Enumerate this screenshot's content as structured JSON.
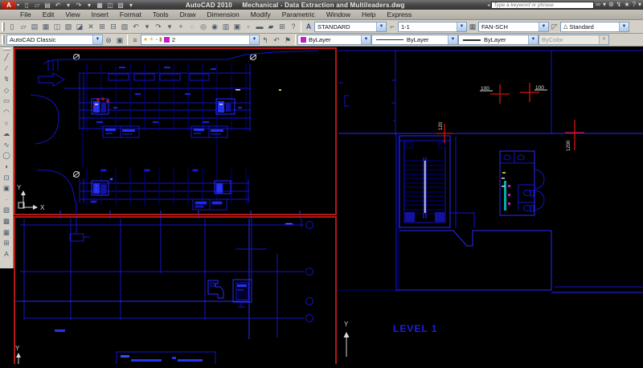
{
  "window": {
    "logo_letter": "A",
    "app_name": "AutoCAD 2010",
    "doc_name": "Mechanical - Data Extraction and Multileaders.dwg",
    "search_placeholder": "Type a keyword or phrase",
    "quick_icons": [
      {
        "n": "new-icon",
        "g": "▯"
      },
      {
        "n": "open-icon",
        "g": "▱"
      },
      {
        "n": "save-icon",
        "g": "▤"
      },
      {
        "n": "undo-icon",
        "g": "↶"
      },
      {
        "n": "undo-dropdown-icon",
        "g": "▾"
      },
      {
        "n": "redo-icon",
        "g": "↷"
      },
      {
        "n": "redo-dropdown-icon",
        "g": "▾"
      },
      {
        "n": "plot-icon",
        "g": "▦"
      },
      {
        "n": "plot-preview-icon",
        "g": "◫"
      },
      {
        "n": "publish-icon",
        "g": "▧"
      },
      {
        "n": "customize-dropdown-icon",
        "g": "▾"
      }
    ],
    "infocenter_icons": [
      {
        "n": "search-icon",
        "g": "∞"
      },
      {
        "n": "search-dropdown-icon",
        "g": "▾"
      },
      {
        "n": "comm-center-icon",
        "g": "⊛"
      },
      {
        "n": "subscription-icon",
        "g": "↯"
      },
      {
        "n": "favorites-icon",
        "g": "★"
      },
      {
        "n": "help-icon",
        "g": "?"
      },
      {
        "n": "help-dropdown-icon",
        "g": "▾"
      }
    ]
  },
  "menus": [
    {
      "n": "menu-file",
      "label": "File"
    },
    {
      "n": "menu-edit",
      "label": "Edit"
    },
    {
      "n": "menu-view",
      "label": "View"
    },
    {
      "n": "menu-insert",
      "label": "Insert"
    },
    {
      "n": "menu-format",
      "label": "Format"
    },
    {
      "n": "menu-tools",
      "label": "Tools"
    },
    {
      "n": "menu-draw",
      "label": "Draw"
    },
    {
      "n": "menu-dimension",
      "label": "Dimension"
    },
    {
      "n": "menu-modify",
      "label": "Modify"
    },
    {
      "n": "menu-parametric",
      "label": "Parametric"
    },
    {
      "n": "menu-window",
      "label": "Window"
    },
    {
      "n": "menu-help",
      "label": "Help"
    },
    {
      "n": "menu-express",
      "label": "Express"
    }
  ],
  "toolbar1": {
    "icons": [
      {
        "n": "qnew-icon",
        "g": "▯"
      },
      {
        "n": "open-icon",
        "g": "▱"
      },
      {
        "n": "qsave-icon",
        "g": "▤"
      },
      {
        "n": "plot-icon",
        "g": "▦"
      },
      {
        "n": "plot-preview-icon",
        "g": "◫"
      },
      {
        "n": "publish-icon",
        "g": "▧"
      },
      {
        "n": "3ddwf-icon",
        "g": "◪"
      },
      {
        "n": "cut-icon",
        "g": "✕"
      },
      {
        "n": "copy-icon",
        "g": "⊞"
      },
      {
        "n": "paste-icon",
        "g": "⊟"
      },
      {
        "n": "match-properties-icon",
        "g": "▨"
      },
      {
        "n": "undo-icon",
        "g": "↶"
      },
      {
        "n": "undo-dropdown-icon",
        "g": "▾"
      },
      {
        "n": "redo-icon",
        "g": "↷"
      },
      {
        "n": "redo-dropdown-icon",
        "g": "▾"
      },
      {
        "n": "pan-icon",
        "g": "+"
      },
      {
        "n": "zoom-realtime-icon",
        "g": "◌"
      },
      {
        "n": "zoom-window-icon",
        "g": "◎"
      },
      {
        "n": "zoom-previous-icon",
        "g": "◉"
      },
      {
        "n": "properties-icon",
        "g": "▥"
      },
      {
        "n": "designcenter-icon",
        "g": "▣"
      },
      {
        "n": "tool-palettes-icon",
        "g": "▫"
      },
      {
        "n": "sheet-set-manager-icon",
        "g": "▬"
      },
      {
        "n": "markup-icon",
        "g": "▰"
      },
      {
        "n": "quickcalc-icon",
        "g": "⊞"
      },
      {
        "n": "help-icon",
        "g": "?"
      }
    ],
    "text_style_icon": "A",
    "text_style": "STANDARD",
    "dim_style": "1-1",
    "table_style": "FAN-SCH",
    "mleader_glyph": "△",
    "mleader_style": "Standard"
  },
  "toolbar2": {
    "workspace": "AutoCAD Classic",
    "workspace_icons": [
      {
        "n": "workspace-settings-icon",
        "g": "⊛"
      },
      {
        "n": "my-workspace-icon",
        "g": "▣"
      }
    ],
    "layer_properties_icon": "≡",
    "layer": {
      "bulb_icon": "●",
      "sun_icon": "☀",
      "plot_icon": "▫",
      "lock_icon": "▮",
      "color_hex": "#c320c3",
      "name": "2"
    },
    "layer_buttons": [
      {
        "n": "make-object-layer-current-icon",
        "g": "↰"
      },
      {
        "n": "layer-previous-icon",
        "g": "↶"
      },
      {
        "n": "layer-states-icon",
        "g": "⚑"
      }
    ],
    "color_value": "ByLayer",
    "color_hex": "#c320c3",
    "linetype_value": "ByLayer",
    "lineweight_value": "ByLayer",
    "plot_style_value": "ByColor"
  },
  "draw_toolbar": {
    "icons": [
      {
        "n": "line-icon",
        "g": "╱"
      },
      {
        "n": "construction-line-icon",
        "g": "∕"
      },
      {
        "n": "polyline-icon",
        "g": "↯"
      },
      {
        "n": "polygon-icon",
        "g": "◇"
      },
      {
        "n": "rectangle-icon",
        "g": "▭"
      },
      {
        "n": "arc-icon",
        "g": "◠"
      },
      {
        "n": "circle-icon",
        "g": "○"
      },
      {
        "n": "revision-cloud-icon",
        "g": "☁"
      },
      {
        "n": "spline-icon",
        "g": "∿"
      },
      {
        "n": "ellipse-icon",
        "g": "◯"
      },
      {
        "n": "ellipse-arc-icon",
        "g": "◖"
      },
      {
        "n": "insert-block-icon",
        "g": "⊡"
      },
      {
        "n": "make-block-icon",
        "g": "▣"
      },
      {
        "n": "point-icon",
        "g": "∙"
      },
      {
        "n": "hatch-icon",
        "g": "▨"
      },
      {
        "n": "gradient-icon",
        "g": "▩"
      },
      {
        "n": "region-icon",
        "g": "▦"
      },
      {
        "n": "table-icon",
        "g": "⊞"
      },
      {
        "n": "multiline-text-icon",
        "g": "A"
      }
    ]
  },
  "canvas": {
    "level_label": "LEVEL 1",
    "dims": {
      "d1": "100",
      "d2": "100",
      "d3": "120",
      "d4": "1200"
    },
    "ucs": {
      "x": "X",
      "y": "Y"
    },
    "colors": {
      "line_blue": "#1414cc",
      "bright_blue": "#2a2aff",
      "viewport_red": "#b41812"
    }
  }
}
